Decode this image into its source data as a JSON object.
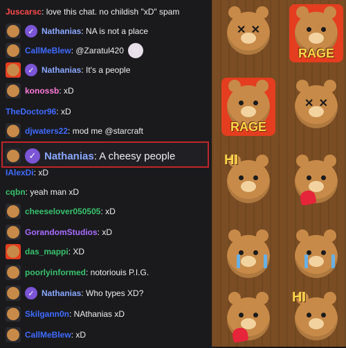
{
  "chat": {
    "messages": [
      {
        "name": "Juscarsc",
        "text": ": love this chat. no childish \"xD\" spam",
        "color": "#ff4a4a",
        "badge": "none",
        "verified": false
      },
      {
        "name": "Nathanias",
        "text": ": NA is not a place",
        "color": "#8aa7ff",
        "badge": "bear-emote",
        "verified": true
      },
      {
        "name": "CallMeBlew",
        "text": ": @Zaratul420",
        "color": "#3f6bff",
        "badge": "bear-emote",
        "verified": false,
        "extra": "avatar"
      },
      {
        "name": "Nathanias",
        "text": ": It's a people",
        "color": "#8aa7ff",
        "badge": "rage-emote",
        "verified": true
      },
      {
        "name": "konossb",
        "text": ": xD",
        "color": "#ff7ad9",
        "badge": "bear-emote",
        "verified": false
      },
      {
        "name": "TheDoctor96",
        "text": ": xD",
        "color": "#3f6bff",
        "badge": "none",
        "verified": false
      },
      {
        "name": "djwaters22",
        "text": ": mod me @starcraft",
        "color": "#3f6bff",
        "badge": "bear-emote",
        "verified": false
      },
      {
        "name": "IAlexDi",
        "text": ": xD",
        "color": "#3f6bff",
        "badge": "none",
        "verified": false
      },
      {
        "name": "cqbn",
        "text": ": yeah man xD",
        "color": "#37c26b",
        "badge": "none",
        "verified": false
      },
      {
        "name": "cheeselover050505",
        "text": ": xD",
        "color": "#37c26b",
        "badge": "bear-emote",
        "verified": false
      },
      {
        "name": "GorandomStudios",
        "text": ": xD",
        "color": "#a86cff",
        "badge": "bear-emote",
        "verified": false
      },
      {
        "name": "das_mappi",
        "text": ": XD",
        "color": "#37c26b",
        "badge": "rage-emote",
        "verified": false
      },
      {
        "name": "poorlyinformed",
        "text": ": notoriouis P.I.G.",
        "color": "#37c26b",
        "badge": "bear-emote",
        "verified": false
      },
      {
        "name": "Nathanias",
        "text": ": Who types XD?",
        "color": "#8aa7ff",
        "badge": "bear-emote",
        "verified": true
      },
      {
        "name": "Skilgann0n",
        "text": ": NAthanias xD",
        "color": "#3f6bff",
        "badge": "bear-emote",
        "verified": false
      },
      {
        "name": "CallMeBlew",
        "text": ": xD",
        "color": "#3f6bff",
        "badge": "bear-emote",
        "verified": false
      }
    ],
    "highlighted": {
      "name": "Nathanias",
      "text": ": A cheesy people",
      "color": "#8aa7ff",
      "verified": true
    }
  },
  "emote_panel": {
    "tiles": [
      {
        "type": "dead",
        "label": ""
      },
      {
        "type": "rage",
        "label": "RAGE"
      },
      {
        "type": "rage",
        "label": "RAGE"
      },
      {
        "type": "dead",
        "label": ""
      },
      {
        "type": "hi",
        "label": "HI"
      },
      {
        "type": "heart",
        "label": ""
      },
      {
        "type": "cry",
        "label": ""
      },
      {
        "type": "cry",
        "label": ""
      },
      {
        "type": "heart",
        "label": ""
      },
      {
        "type": "hi",
        "label": "HI"
      }
    ]
  }
}
